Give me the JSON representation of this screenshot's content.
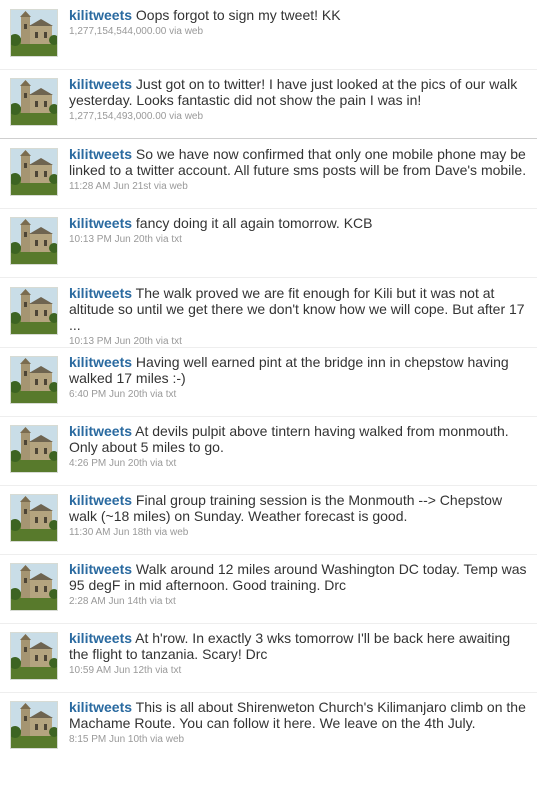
{
  "screen_name": "kilitweets",
  "avatar_icon": "church-avatar-icon",
  "colors": {
    "link": "#2a6aa0",
    "text": "#333333",
    "meta": "#999999"
  },
  "tweets": [
    {
      "text": "Oops forgot to sign my tweet! KK",
      "timestamp": "1,277,154,544,000.00",
      "via": "via",
      "source": "web"
    },
    {
      "text": "Just got on to twitter! I have just looked at the pics of our walk yesterday. Looks fantastic did not show the pain I was in!",
      "timestamp": "1,277,154,493,000.00",
      "via": "via",
      "source": "web"
    },
    {
      "text": "So we have now confirmed that only one mobile phone may be linked to a twitter account. All future sms posts will be from Dave's mobile.",
      "timestamp": "11:28 AM Jun 21st",
      "via": "via",
      "source": "web"
    },
    {
      "text": "fancy doing it all again tomorrow. KCB",
      "timestamp": "10:13 PM Jun 20th",
      "via": "via",
      "source": "txt"
    },
    {
      "text": "The walk proved we are fit enough for Kili but it was not at altitude so until we get there we don't know how we will cope. But after 17 ...",
      "timestamp": "10:13 PM Jun 20th",
      "via": "via",
      "source": "txt"
    },
    {
      "text": "Having well earned pint at the bridge inn in chepstow having walked 17 miles :-)",
      "timestamp": "6:40 PM Jun 20th",
      "via": "via",
      "source": "txt"
    },
    {
      "text": "At devils pulpit above tintern having walked from monmouth. Only about 5 miles to go.",
      "timestamp": "4:26 PM Jun 20th",
      "via": "via",
      "source": "txt"
    },
    {
      "text": "Final group training session is the Monmouth --> Chepstow walk (~18 miles) on Sunday. Weather forecast is good.",
      "timestamp": "11:30 AM Jun 18th",
      "via": "via",
      "source": "web"
    },
    {
      "text": "Walk around 12 miles around Washington DC today. Temp was 95 degF in mid afternoon. Good training. Drc",
      "timestamp": "2:28 AM Jun 14th",
      "via": "via",
      "source": "txt"
    },
    {
      "text": "At h'row. In exactly 3 wks tomorrow I'll be back here awaiting the flight to tanzania. Scary! Drc",
      "timestamp": "10:59 AM Jun 12th",
      "via": "via",
      "source": "txt"
    },
    {
      "text": "This is all about Shirenweton Church's Kilimanjaro climb on the Machame Route. You can follow it here. We leave on the 4th July.",
      "timestamp": "8:15 PM Jun 10th",
      "via": "via",
      "source": "web"
    }
  ]
}
